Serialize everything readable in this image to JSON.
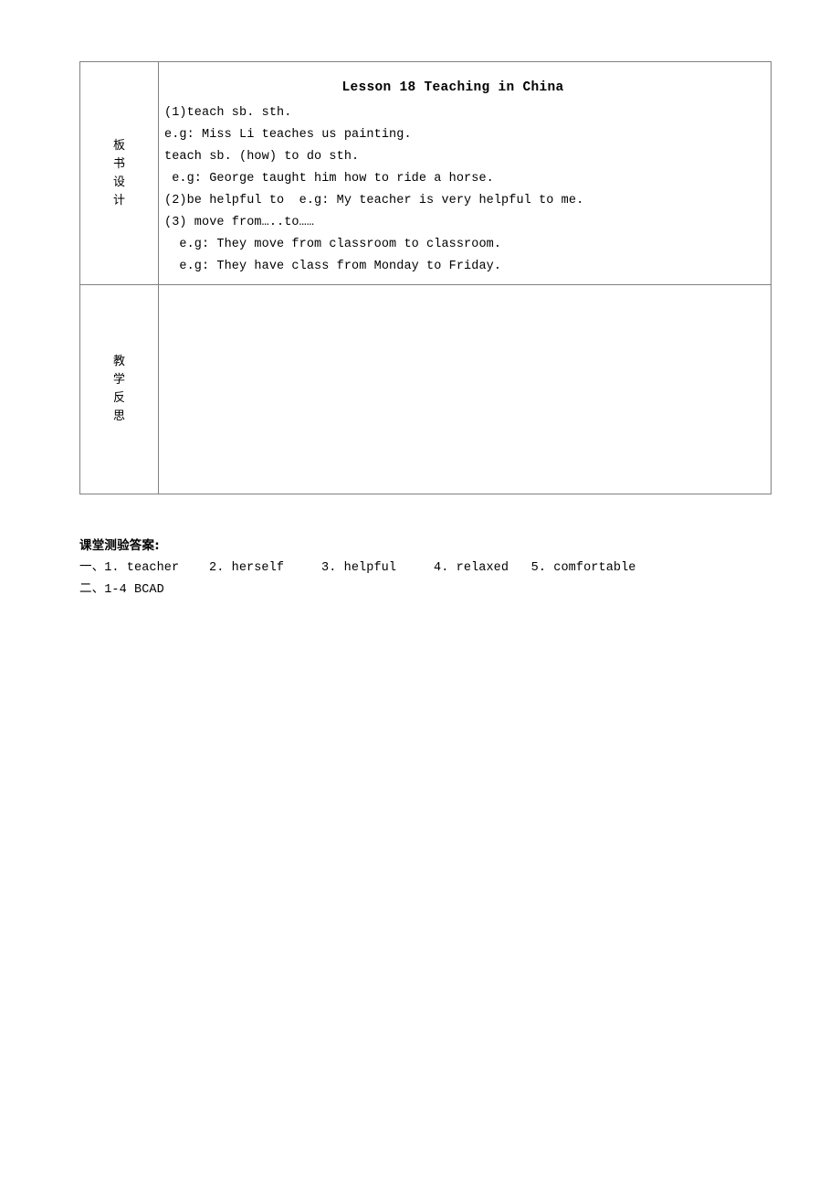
{
  "document": {
    "type": "lesson-plan-table",
    "border_color": "#808080",
    "text_color": "#000000",
    "background": "#ffffff"
  },
  "table": {
    "rows": [
      {
        "label_chars": [
          "板",
          "书",
          "设",
          "计"
        ],
        "label_text": "板书设计",
        "body": {
          "title": "Lesson 18  Teaching in China",
          "lines": [
            "(1)teach sb. sth.",
            "e.g: Miss Li teaches us painting.",
            "teach sb. (how) to do sth.",
            " e.g: George taught him how to ride a horse.",
            "(2)be helpful to  e.g: My teacher is very helpful to me.",
            "(3) move from…..to……",
            "  e.g: They move from classroom to classroom.",
            "  e.g: They have class from Monday to Friday."
          ]
        }
      },
      {
        "label_chars": [
          "教",
          "学",
          "反",
          "思"
        ],
        "label_text": "教学反思",
        "body": {
          "title": "",
          "lines": []
        }
      }
    ]
  },
  "answers": {
    "heading": "课堂测验答案:",
    "lines": [
      "一、1. teacher    2. herself     3. helpful     4. relaxed   5. comfortable",
      "二、1-4 BCAD"
    ]
  }
}
